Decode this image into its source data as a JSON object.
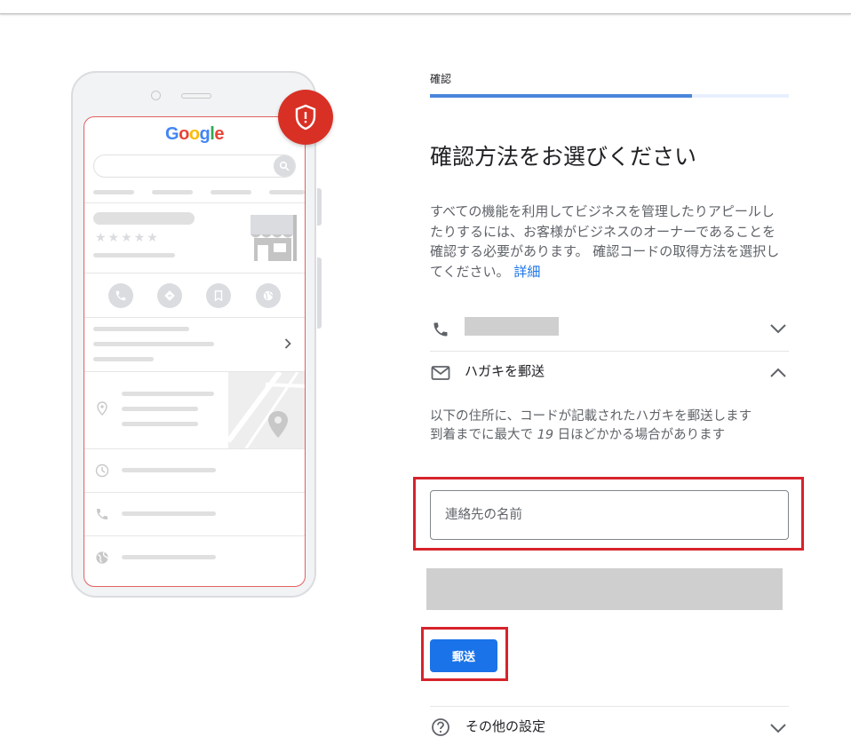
{
  "verification": {
    "step_label": "確認",
    "progress_fraction": 0.73,
    "heading": "確認方法をお選びください",
    "description": "すべての機能を利用してビジネスを管理したりアピールしたりするには、お客様がビジネスのオーナーであることを確認する必要があります。 確認コードの取得方法を選択してください。",
    "learn_more": "詳細"
  },
  "options": {
    "phone": {
      "icon": "phone-icon",
      "expanded": false
    },
    "postcard": {
      "icon": "mail-icon",
      "label": "ハガキを郵送",
      "expanded": true,
      "desc_line1": "以下の住所に、コードが記載されたハガキを郵送します",
      "desc_prefix": "到着までに最大で ",
      "days": "19",
      "desc_suffix": " 日ほどかかる場合があります",
      "contact_name_placeholder": "連絡先の名前",
      "contact_name_value": "",
      "send_label": "郵送"
    },
    "other": {
      "icon": "help-circle-icon",
      "label": "その他の設定",
      "expanded": false
    }
  },
  "illustration": {
    "logo": {
      "G": "G",
      "o1": "o",
      "o2": "o",
      "g": "g",
      "l": "l",
      "e": "e"
    },
    "stars": "★★★★★",
    "colors": {
      "alert": "#d93025",
      "accent": "#1a73e8",
      "highlight": "#d7232b"
    }
  }
}
